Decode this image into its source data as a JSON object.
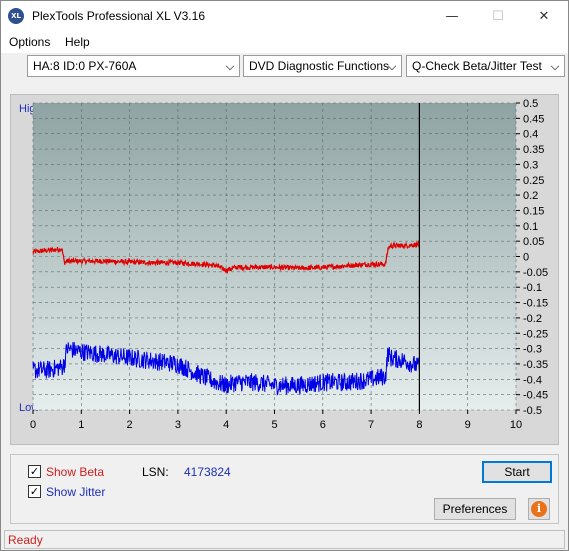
{
  "window": {
    "title": "PlexTools Professional XL V3.16",
    "icon_text": "XL",
    "minimize_glyph": "—",
    "maximize_glyph": "☐",
    "close_glyph": "✕"
  },
  "menu": {
    "options": "Options",
    "help": "Help"
  },
  "toolbar": {
    "device": "HA:8 ID:0  PX-760A",
    "function": "DVD Diagnostic Functions",
    "test": "Q-Check Beta/Jitter Test"
  },
  "chart": {
    "high_label": "High",
    "low_label": "Low"
  },
  "controls": {
    "show_beta": "Show Beta",
    "show_beta_checked": true,
    "show_jitter": "Show Jitter",
    "show_jitter_checked": true,
    "lsn_label": "LSN:",
    "lsn_value": "4173824",
    "start_button": "Start",
    "preferences_button": "Preferences",
    "info_icon": "info-icon"
  },
  "status": {
    "text": "Ready"
  },
  "colors": {
    "beta": "#e00000",
    "jitter": "#0000e6",
    "plot_bg_top": "#8fa3a3",
    "plot_bg_bottom": "#e3eaea",
    "label_blue": "#1d2fb8",
    "status_red": "#d02020"
  },
  "chart_data": {
    "type": "line",
    "x_ticks": [
      "0",
      "1",
      "2",
      "3",
      "4",
      "5",
      "6",
      "7",
      "8",
      "9",
      "10"
    ],
    "y_ticks": [
      "0.5",
      "0.45",
      "0.4",
      "0.35",
      "0.3",
      "0.25",
      "0.2",
      "0.15",
      "0.1",
      "0.05",
      "0",
      "-0.05",
      "-0.1",
      "-0.15",
      "-0.2",
      "-0.25",
      "-0.3",
      "-0.35",
      "-0.4",
      "-0.45",
      "-0.5"
    ],
    "xlim": [
      0,
      10
    ],
    "ylim": [
      -0.5,
      0.5
    ],
    "marker_x": 8.0,
    "series": [
      {
        "name": "Beta",
        "color": "#e00000",
        "x": [
          0,
          0.3,
          0.6,
          0.65,
          0.7,
          1.0,
          1.5,
          2.0,
          2.5,
          3.0,
          3.5,
          3.8,
          4.0,
          4.2,
          4.6,
          5.0,
          5.5,
          6.0,
          6.5,
          7.0,
          7.3,
          7.35,
          7.4,
          7.7,
          8.0
        ],
        "y": [
          0.015,
          0.02,
          0.025,
          -0.02,
          -0.015,
          -0.015,
          -0.015,
          -0.018,
          -0.02,
          -0.02,
          -0.025,
          -0.03,
          -0.045,
          -0.035,
          -0.035,
          -0.035,
          -0.038,
          -0.036,
          -0.03,
          -0.025,
          -0.025,
          0.025,
          0.035,
          0.035,
          0.04
        ],
        "noise": 0.008
      },
      {
        "name": "Jitter",
        "color": "#0000e6",
        "x": [
          0,
          0.3,
          0.6,
          0.65,
          0.7,
          1.0,
          1.5,
          2.0,
          2.5,
          3.0,
          3.5,
          3.8,
          4.0,
          4.2,
          4.6,
          5.0,
          5.5,
          6.0,
          6.5,
          7.0,
          7.3,
          7.35,
          7.4,
          7.7,
          8.0
        ],
        "y": [
          -0.37,
          -0.37,
          -0.36,
          -0.35,
          -0.3,
          -0.31,
          -0.32,
          -0.33,
          -0.34,
          -0.35,
          -0.39,
          -0.41,
          -0.42,
          -0.41,
          -0.41,
          -0.42,
          -0.42,
          -0.41,
          -0.41,
          -0.4,
          -0.39,
          -0.31,
          -0.33,
          -0.34,
          -0.36
        ],
        "noise": 0.03
      }
    ]
  }
}
